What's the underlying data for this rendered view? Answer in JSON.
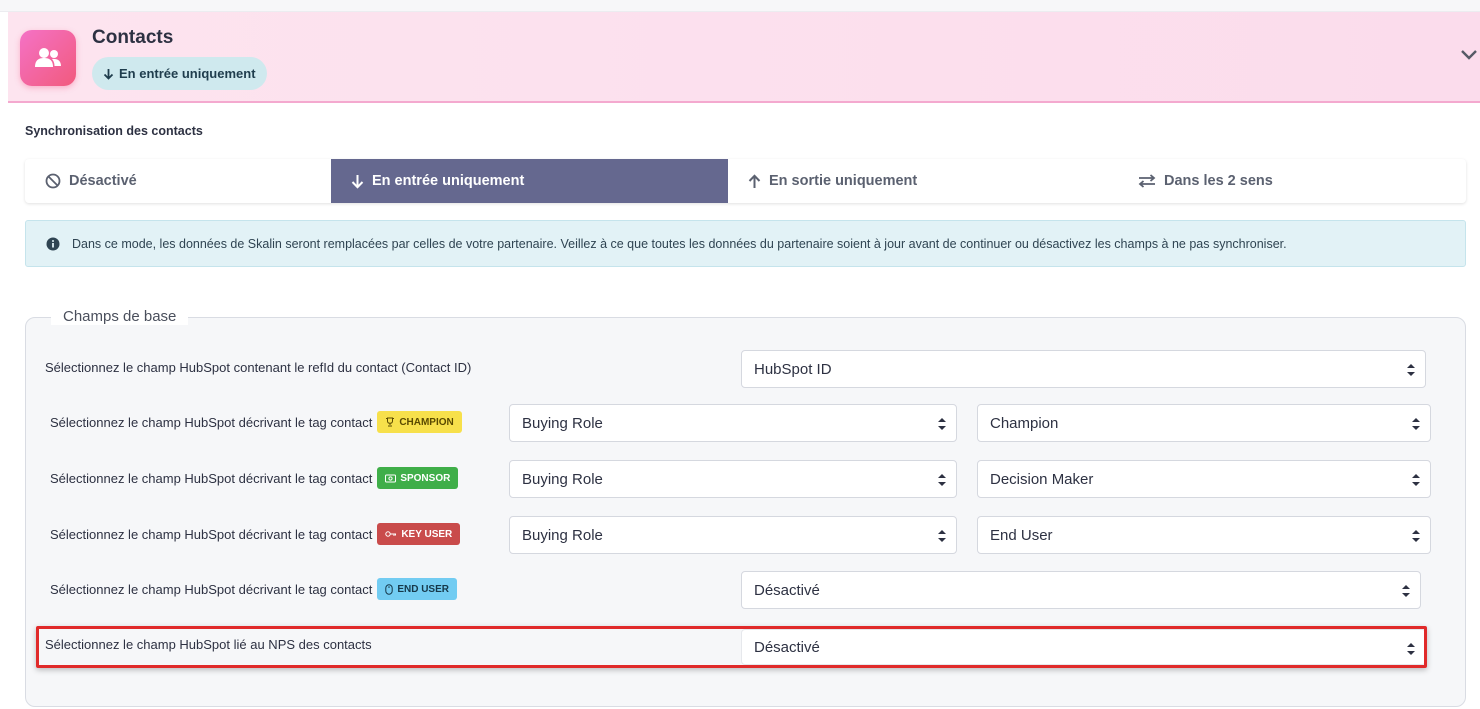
{
  "header": {
    "title": "Contacts",
    "mode_pill": "En entrée uniquement",
    "accent_color": "#f25a7d"
  },
  "sync": {
    "section_title": "Synchronisation des contacts",
    "tabs": [
      {
        "label": "Désactivé",
        "icon": "ban-icon",
        "active": false
      },
      {
        "label": "En entrée uniquement",
        "icon": "arrow-down-icon",
        "active": true
      },
      {
        "label": "En sortie uniquement",
        "icon": "arrow-up-icon",
        "active": false
      },
      {
        "label": "Dans les 2 sens",
        "icon": "arrows-exchange-icon",
        "active": false
      }
    ],
    "active_tab_color": "#65688f"
  },
  "info": {
    "text": "Dans ce mode, les données de Skalin seront remplacées par celles de votre partenaire. Veillez à ce que toutes les données du partenaire soient à jour avant de continuer ou désactivez les champs à ne pas synchroniser."
  },
  "base_fields": {
    "legend": "Champs de base",
    "rows": [
      {
        "label": "Sélectionnez le champ HubSpot contenant le refId du contact (Contact ID)",
        "select1": "HubSpot ID"
      },
      {
        "label": "Sélectionnez le champ HubSpot décrivant le tag contact",
        "tag": "CHAMPION",
        "tag_icon": "trophy-icon",
        "select1": "Buying Role",
        "select2": "Champion"
      },
      {
        "label": "Sélectionnez le champ HubSpot décrivant le tag contact",
        "tag": "SPONSOR",
        "tag_icon": "money-icon",
        "select1": "Buying Role",
        "select2": "Decision Maker"
      },
      {
        "label": "Sélectionnez le champ HubSpot décrivant le tag contact",
        "tag": "KEY USER",
        "tag_icon": "key-icon",
        "select1": "Buying Role",
        "select2": "End User"
      },
      {
        "label": "Sélectionnez le champ HubSpot décrivant le tag contact",
        "tag": "END USER",
        "tag_icon": "mouse-icon",
        "select1": "Désactivé"
      },
      {
        "label": "Sélectionnez le champ HubSpot lié au NPS des contacts",
        "select1": "Désactivé",
        "highlighted": true
      }
    ]
  },
  "colors": {
    "highlight": "#e02a2a",
    "champion": "#f7e04b",
    "sponsor": "#3fae49",
    "key_user": "#c94b4b",
    "end_user": "#72ccf2"
  }
}
